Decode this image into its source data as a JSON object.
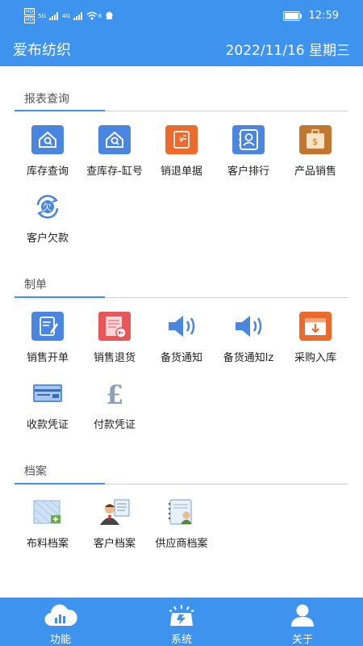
{
  "statusbar": {
    "time": "12:59",
    "left_labels": {
      "hd1": "HD",
      "hd2": "HD",
      "net1": "5G",
      "net2": "4G",
      "wifi_num": "6"
    }
  },
  "header": {
    "title": "爱布纺织",
    "date": "2022/11/16 星期三"
  },
  "sections": [
    {
      "title": "报表查询",
      "items": [
        {
          "label": "库存查询",
          "icon": "house-search-icon"
        },
        {
          "label": "查库存-缸号",
          "icon": "house-search-icon"
        },
        {
          "label": "销退单据",
          "icon": "receipt-yen-icon"
        },
        {
          "label": "客户排行",
          "icon": "contact-book-icon"
        },
        {
          "label": "产品销售",
          "icon": "money-bag-icon"
        },
        {
          "label": "客户欠款",
          "icon": "debt-refresh-icon"
        }
      ]
    },
    {
      "title": "制单",
      "items": [
        {
          "label": "销售开单",
          "icon": "edit-document-icon"
        },
        {
          "label": "销售退货",
          "icon": "return-document-icon"
        },
        {
          "label": "备货通知",
          "icon": "speaker-icon"
        },
        {
          "label": "备货通知lz",
          "icon": "speaker-icon"
        },
        {
          "label": "采购入库",
          "icon": "inbox-download-icon"
        },
        {
          "label": "收款凭证",
          "icon": "bank-card-icon"
        },
        {
          "label": "付款凭证",
          "icon": "pound-icon"
        }
      ]
    },
    {
      "title": "档案",
      "items": [
        {
          "label": "布料档案",
          "icon": "fabric-file-icon"
        },
        {
          "label": "客户档案",
          "icon": "customer-file-icon"
        },
        {
          "label": "供应商档案",
          "icon": "supplier-file-icon"
        }
      ]
    }
  ],
  "bottom_nav": [
    {
      "label": "功能",
      "icon": "cloud-chart-icon"
    },
    {
      "label": "系统",
      "icon": "system-monitor-icon"
    },
    {
      "label": "关于",
      "icon": "user-icon"
    }
  ],
  "colors": {
    "primary": "#3d93ee",
    "orange": "#ec6a2c",
    "blue_icon": "#4a86e0",
    "divider": "#d0d0d0"
  }
}
